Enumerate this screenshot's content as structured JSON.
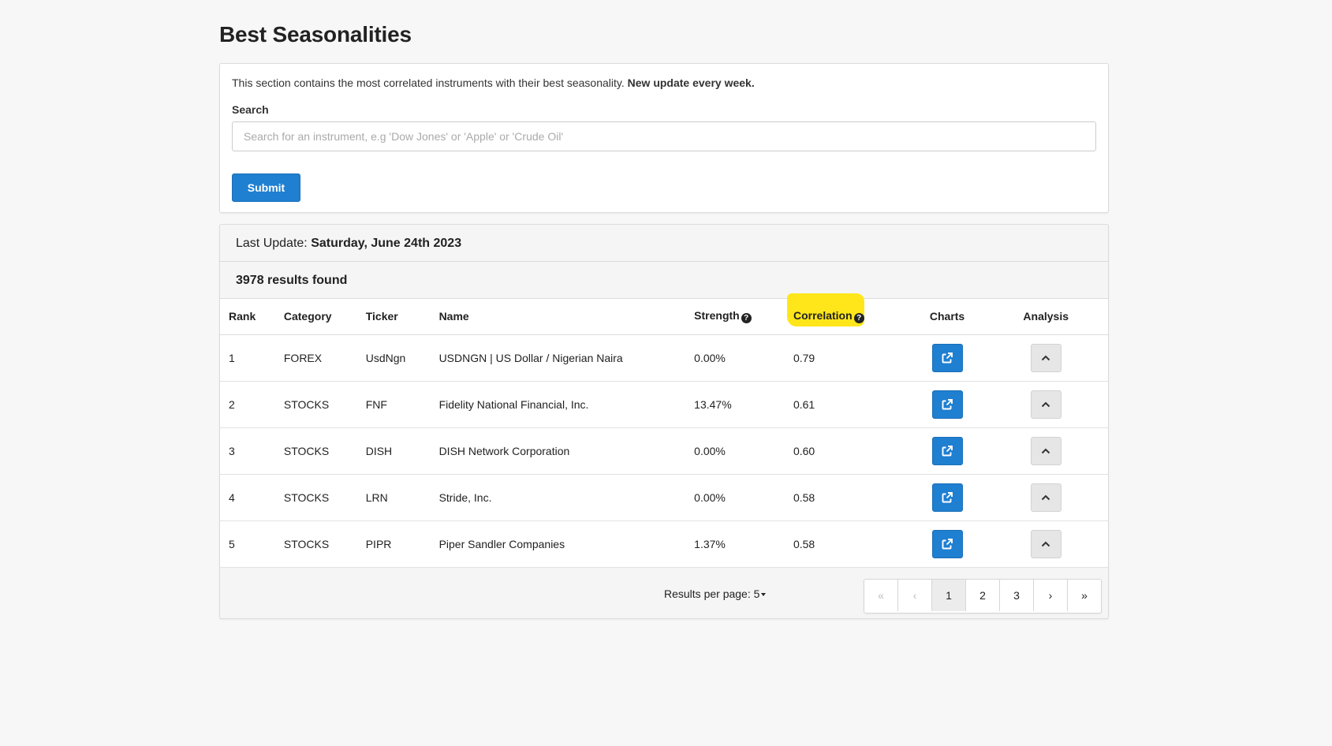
{
  "page": {
    "title": "Best Seasonalities"
  },
  "search_section": {
    "intro_text": "This section contains the most correlated instruments with their best seasonality.",
    "intro_bold": "New update every week.",
    "search_label": "Search",
    "search_placeholder": "Search for an instrument, e.g 'Dow Jones' or 'Apple' or 'Crude Oil'",
    "search_value": "",
    "submit_label": "Submit"
  },
  "results": {
    "last_update_label": "Last Update:",
    "last_update_value": "Saturday, June 24th 2023",
    "count_text": "3978 results found",
    "columns": {
      "rank": "Rank",
      "category": "Category",
      "ticker": "Ticker",
      "name": "Name",
      "strength": "Strength",
      "correlation": "Correlation",
      "charts": "Charts",
      "analysis": "Analysis"
    },
    "highlight_color": "#ffe61a",
    "rows": [
      {
        "rank": "1",
        "category": "FOREX",
        "ticker": "UsdNgn",
        "name": "USDNGN | US Dollar / Nigerian Naira",
        "strength": "0.00%",
        "correlation": "0.79"
      },
      {
        "rank": "2",
        "category": "STOCKS",
        "ticker": "FNF",
        "name": "Fidelity National Financial, Inc.",
        "strength": "13.47%",
        "correlation": "0.61"
      },
      {
        "rank": "3",
        "category": "STOCKS",
        "ticker": "DISH",
        "name": "DISH Network Corporation",
        "strength": "0.00%",
        "correlation": "0.60"
      },
      {
        "rank": "4",
        "category": "STOCKS",
        "ticker": "LRN",
        "name": "Stride, Inc.",
        "strength": "0.00%",
        "correlation": "0.58"
      },
      {
        "rank": "5",
        "category": "STOCKS",
        "ticker": "PIPR",
        "name": "Piper Sandler Companies",
        "strength": "1.37%",
        "correlation": "0.58"
      }
    ]
  },
  "pagination": {
    "per_page_label": "Results per page:",
    "per_page_value": "5",
    "first_label": "«",
    "prev_label": "‹",
    "pages": [
      "1",
      "2",
      "3"
    ],
    "next_label": "›",
    "last_label": "»",
    "current_page": "1"
  },
  "colors": {
    "primary_button": "#1f7fd1",
    "background": "#f7f7f7"
  }
}
